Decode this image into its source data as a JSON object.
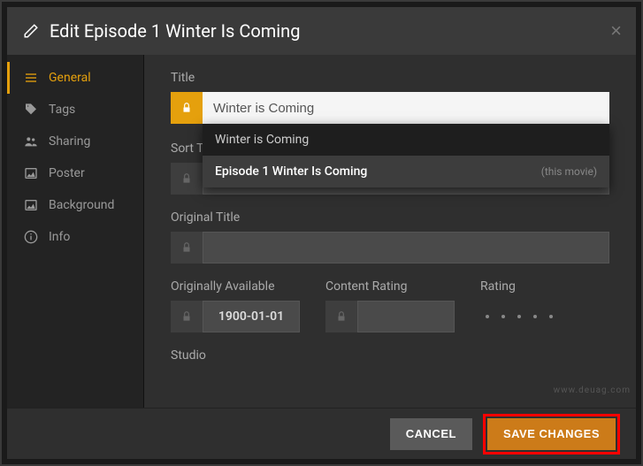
{
  "header": {
    "title": "Edit Episode 1 Winter Is Coming"
  },
  "sidebar": {
    "items": [
      {
        "label": "General"
      },
      {
        "label": "Tags"
      },
      {
        "label": "Sharing"
      },
      {
        "label": "Poster"
      },
      {
        "label": "Background"
      },
      {
        "label": "Info"
      }
    ]
  },
  "fields": {
    "title_label": "Title",
    "title_value": "Winter is Coming",
    "sort_title_label": "Sort T",
    "original_title_label": "Original Title",
    "originally_available_label": "Originally Available",
    "originally_available_value": "1900-01-01",
    "content_rating_label": "Content Rating",
    "rating_label": "Rating",
    "studio_label": "Studio"
  },
  "autocomplete": {
    "items": [
      {
        "label": "Winter is Coming",
        "hint": ""
      },
      {
        "label": "Episode 1 Winter Is Coming",
        "hint": "(this movie)"
      }
    ]
  },
  "footer": {
    "cancel": "CANCEL",
    "save": "SAVE CHANGES"
  },
  "watermark": "www.deuag.com"
}
